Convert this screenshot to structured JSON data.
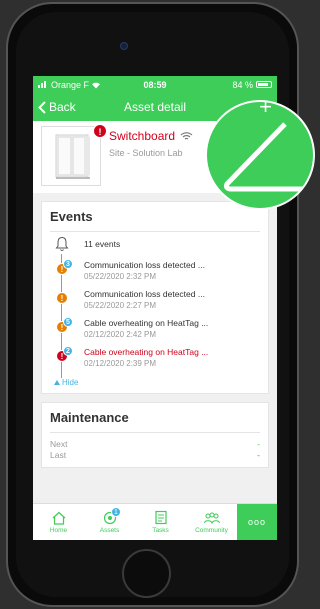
{
  "status_bar": {
    "carrier": "Orange F",
    "time": "08:59",
    "battery": "84 %",
    "battery_level": 0.84
  },
  "nav": {
    "back_label": "Back",
    "title": "Asset detail",
    "add_label": "+"
  },
  "asset": {
    "name": "Switchboard",
    "site": "Site - Solution Lab",
    "alert_badge": "!"
  },
  "events": {
    "title": "Events",
    "count_text": "11 events",
    "items": [
      {
        "title": "Communication loss detected ...",
        "date": "05/22/2020 2:32 PM",
        "severity": "orange",
        "badge": "!",
        "count": "3",
        "title_color": "default"
      },
      {
        "title": "Communication loss detected ...",
        "date": "05/22/2020 2:27 PM",
        "severity": "orange",
        "badge": "!",
        "count": "",
        "title_color": "default"
      },
      {
        "title": "Cable overheating on HeatTag ...",
        "date": "02/12/2020 2:42 PM",
        "severity": "orange",
        "badge": "!",
        "count": "5",
        "title_color": "default"
      },
      {
        "title": "Cable overheating on HeatTag ...",
        "date": "02/12/2020 2:39 PM",
        "severity": "red",
        "badge": "!",
        "count": "2",
        "title_color": "red"
      }
    ],
    "hide_label": "Hide"
  },
  "maintenance": {
    "title": "Maintenance",
    "rows": [
      {
        "label": "Next",
        "value": "-"
      },
      {
        "label": "Last",
        "value": "-"
      }
    ]
  },
  "tabbar": {
    "tabs": [
      {
        "label": "Home",
        "icon": "home-icon"
      },
      {
        "label": "Assets",
        "icon": "assets-icon",
        "badge": "1"
      },
      {
        "label": "Tasks",
        "icon": "tasks-icon"
      },
      {
        "label": "Community",
        "icon": "community-icon"
      }
    ],
    "more_label": "ooo"
  },
  "colors": {
    "brand_green": "#3dcd58",
    "alert_red": "#d0021b",
    "warning_orange": "#e47f00",
    "info_blue": "#42b4e6"
  }
}
